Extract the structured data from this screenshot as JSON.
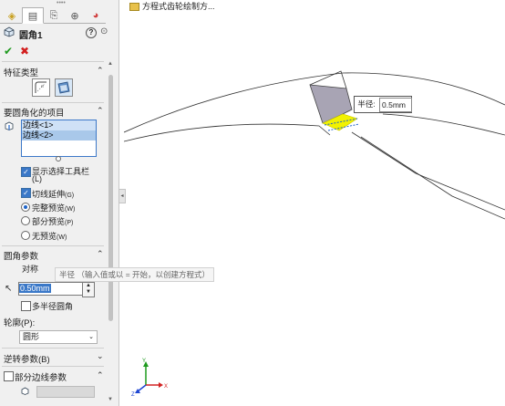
{
  "panel": {
    "title": "圆角1",
    "ok_label": "✔",
    "cancel_label": "✖",
    "feature_type": {
      "title": "特征类型"
    },
    "items": {
      "title": "要圆角化的项目",
      "list": [
        "边线<1>",
        "边线<2>"
      ],
      "options": [
        {
          "label": "显示选择工具栏",
          "sublabel": "(L)",
          "checked": true
        },
        {
          "label": "切线延伸",
          "shortcut": "(G)",
          "checked": true
        }
      ],
      "radios": [
        {
          "label": "完整预览",
          "shortcut": "(W)",
          "selected": true
        },
        {
          "label": "部分预览",
          "shortcut": "(P)",
          "selected": false
        },
        {
          "label": "无预览",
          "shortcut": "(W)",
          "selected": false
        }
      ]
    },
    "fillet_params": {
      "title": "圆角参数",
      "symmetry": "对称",
      "radius_value": "0.50mm",
      "tooltip": "半径 （输入值或以 = 开始，以创建方程式）",
      "multi_radius_label": "多半径圆角",
      "profile_label": "轮廓(P):",
      "profile_value": "圆形"
    },
    "reverse_params": {
      "title": "逆转参数(B)"
    },
    "partial_edge": {
      "title": "部分边线参数"
    }
  },
  "graphics": {
    "tree_item": "方程式齿轮绘制方...",
    "callout_label": "半径:",
    "callout_value": "0.5mm"
  },
  "colors": {
    "face_fill": "#a8a4b4",
    "preview_yellow": "#f2f200",
    "axis_x": "#d22222",
    "axis_y": "#1e9a1e",
    "axis_z": "#1e46d2"
  }
}
